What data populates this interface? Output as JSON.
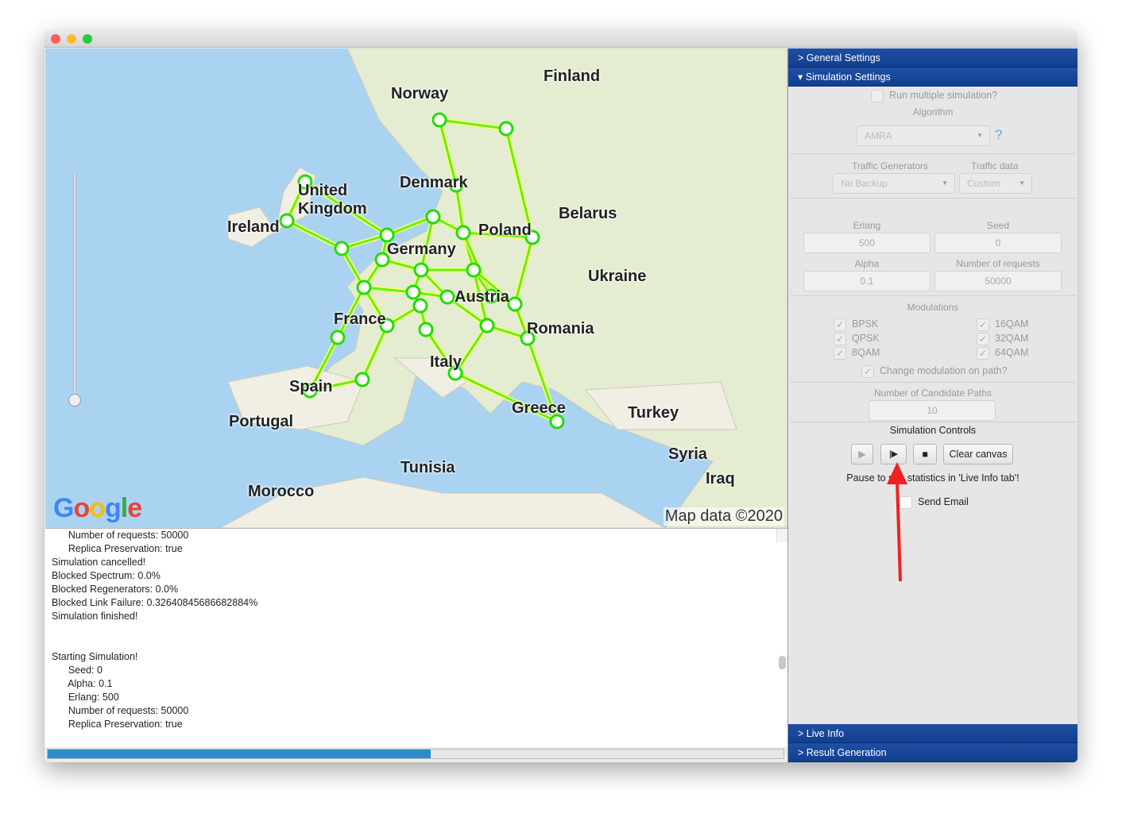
{
  "window": {
    "controls": [
      "close",
      "minimize",
      "maximize"
    ]
  },
  "map": {
    "labels": [
      "Finland",
      "Norway",
      "Denmark",
      "United Kingdom",
      "Ireland",
      "Belarus",
      "Poland",
      "Germany",
      "Ukraine",
      "France",
      "Austria",
      "Romania",
      "Italy",
      "Spain",
      "Portugal",
      "Greece",
      "Turkey",
      "Syria",
      "Iraq",
      "Tunisia",
      "Morocco"
    ],
    "logo": "Google",
    "attribution": "Map data ©2020",
    "node_color": "#22dd00",
    "link_color": "#66ee22"
  },
  "log": {
    "lines": [
      "      Number of requests: 50000",
      "      Replica Preservation: true",
      "Simulation cancelled!",
      "Blocked Spectrum: 0.0%",
      "Blocked Regenerators: 0.0%",
      "Blocked Link Failure: 0.32640845686682884%",
      "Simulation finished!",
      "",
      "",
      "Starting Simulation!",
      "      Seed: 0",
      "      Alpha: 0.1",
      "      Erlang: 500",
      "      Number of requests: 50000",
      "      Replica Preservation: true"
    ]
  },
  "progress": {
    "percent": 52,
    "color": "#2a8fc8"
  },
  "panel": {
    "general_settings": "General Settings",
    "simulation_settings": "Simulation Settings",
    "run_multiple": "Run multiple simulation?",
    "algorithm_label": "Algorithm",
    "algorithm_value": "AMRA",
    "help": "?",
    "traffic_generators_label": "Traffic Generators",
    "traffic_generators_value": "No Backup",
    "traffic_data_label": "Traffic data",
    "traffic_data_value": "Custom",
    "erlang_label": "Erlang",
    "erlang": "500",
    "seed_label": "Seed",
    "seed": "0",
    "alpha_label": "Alpha",
    "alpha": "0.1",
    "requests_label": "Number of requests",
    "requests": "50000",
    "modulations_label": "Modulations",
    "modulations": [
      {
        "name": "BPSK",
        "checked": true
      },
      {
        "name": "QPSK",
        "checked": true
      },
      {
        "name": "8QAM",
        "checked": true
      },
      {
        "name": "16QAM",
        "checked": true
      },
      {
        "name": "32QAM",
        "checked": true
      },
      {
        "name": "64QAM",
        "checked": true
      }
    ],
    "change_modulation": "Change modulation on path?",
    "candidate_paths_label": "Number of Candidate Paths",
    "candidate_paths": "10",
    "controls_label": "Simulation Controls",
    "clear_canvas": "Clear canvas",
    "pause_hint": "Pause to see statistics in 'Live Info tab'!",
    "send_email": "Send Email",
    "live_info": "Live Info",
    "result_generation": "Result Generation",
    "header_color": "#1a4a9c"
  },
  "annotation": {
    "arrow_color": "#ee2222"
  }
}
